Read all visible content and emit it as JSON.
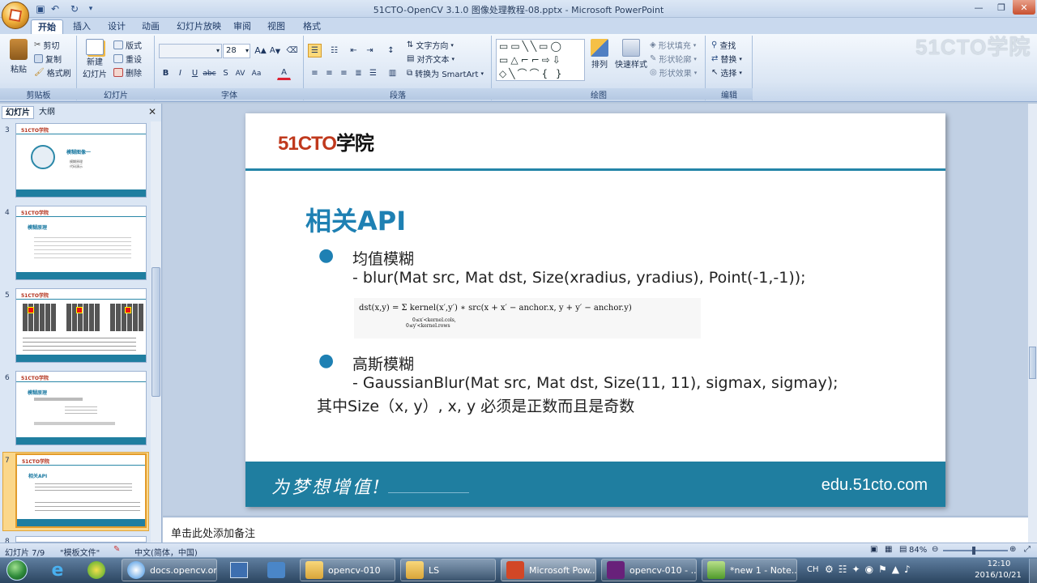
{
  "window": {
    "title": "51CTO-OpenCV 3.1.0 图像处理教程-08.pptx - Microsoft PowerPoint"
  },
  "tabs": [
    "开始",
    "插入",
    "设计",
    "动画",
    "幻灯片放映",
    "审阅",
    "视图",
    "格式"
  ],
  "ribbon": {
    "clipboard": {
      "label": "剪贴板",
      "paste": "粘贴",
      "cut": "剪切",
      "copy": "复制",
      "format_painter": "格式刷"
    },
    "slides": {
      "label": "幻灯片",
      "new_slide_1": "新建",
      "new_slide_2": "幻灯片",
      "layout": "版式",
      "reset": "重设",
      "delete": "删除"
    },
    "font": {
      "label": "字体",
      "size": "28"
    },
    "paragraph": {
      "label": "段落",
      "text_direction": "文字方向",
      "align_text": "对齐文本",
      "smartart": "转换为 SmartArt"
    },
    "drawing": {
      "label": "绘图",
      "arrange": "排列",
      "quick_styles": "快速样式",
      "shape_fill": "形状填充",
      "shape_outline": "形状轮廓",
      "shape_effects": "形状效果"
    },
    "editing": {
      "label": "编辑",
      "find": "查找",
      "replace": "替换",
      "select": "选择"
    }
  },
  "watermark": "51CTO学院",
  "panel": {
    "tab_slides": "幻灯片",
    "tab_outline": "大纲"
  },
  "thumbs": [
    {
      "num": "3",
      "title": "模糊图像一",
      "l1": "模糊原理",
      "l2": "代码演示"
    },
    {
      "num": "4",
      "title": "模糊原理"
    },
    {
      "num": "5"
    },
    {
      "num": "6",
      "title": "模糊原理"
    },
    {
      "num": "7",
      "title": "相关API"
    },
    {
      "num": "8"
    }
  ],
  "slide": {
    "logo_a": "51CTO",
    "logo_b": "学院",
    "title": "相关API",
    "b1_head": "均值模糊",
    "b1_text": "- blur(Mat src, Mat dst, Size(xradius, yradius), Point(-1,-1));",
    "formula": "dst(x,y) = Σ kernel(x′,y′) ∗ src(x + x′ − anchor.x, y + y′ − anchor.y)",
    "formula_sub1": "0≤x′<kernel.cols,",
    "formula_sub2": "0≤y′<kernel.rows",
    "b2_head": "高斯模糊",
    "b2_text": "- GaussianBlur(Mat src, Mat dst, Size(11, 11), sigmax, sigmay);",
    "note_line": "其中Size（x, y）, x, y 必须是正数而且是奇数",
    "slogan": "为梦想增值!",
    "url": "edu.51cto.com"
  },
  "notes_placeholder": "单击此处添加备注",
  "status": {
    "slide": "幻灯片 7/9",
    "theme": "\"模板文件\"",
    "lang": "中文(简体，中国)",
    "zoom": "84%"
  },
  "taskbar": {
    "t1": "docs.opencv.or...",
    "t2": "opencv-010",
    "t3": "LS",
    "t4": "Microsoft Pow...",
    "t5": "opencv-010 - ...",
    "t6": "*new 1 - Note...",
    "ime": "CH",
    "time": "12:10",
    "date": "2016/10/21"
  }
}
